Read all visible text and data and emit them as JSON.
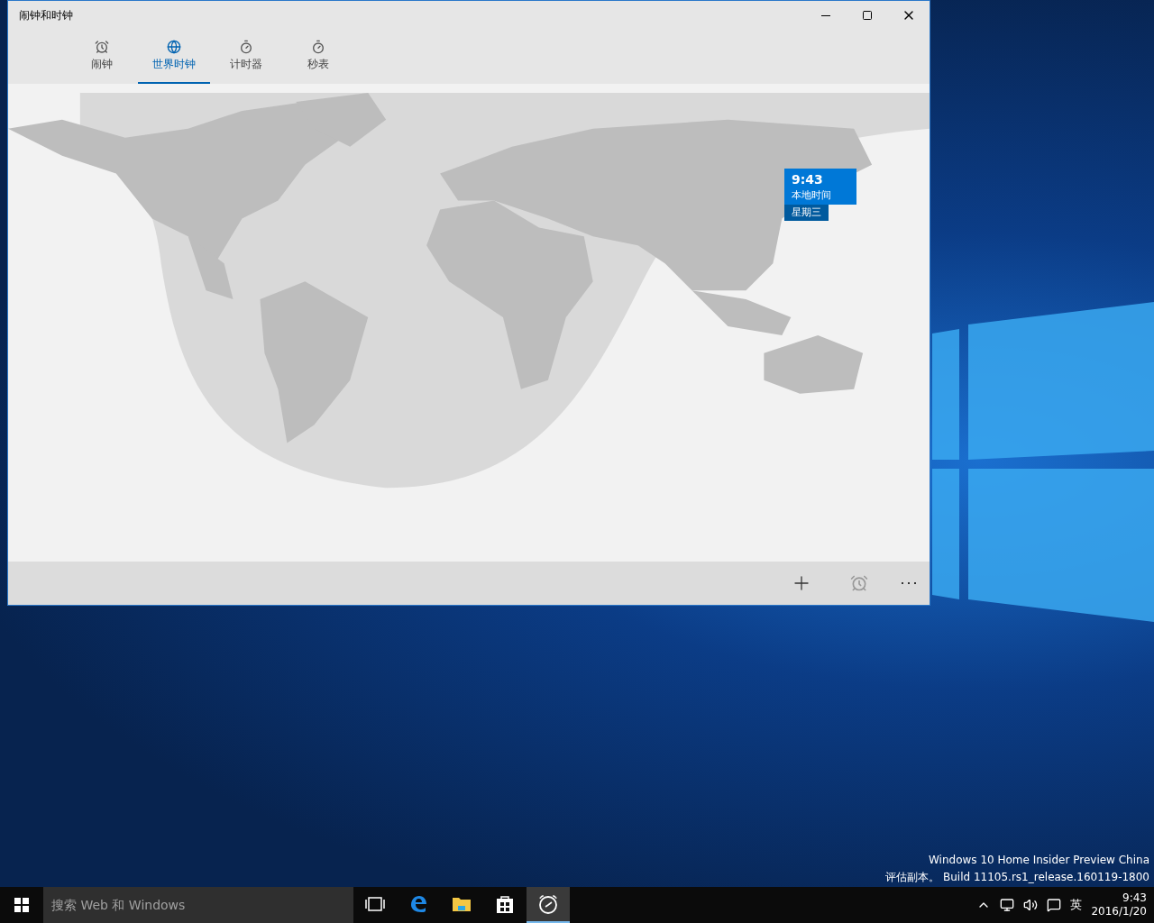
{
  "window": {
    "title": "闹钟和时钟"
  },
  "tabs": [
    {
      "kind": "alarm",
      "label": "闹钟",
      "selected": false
    },
    {
      "kind": "world",
      "label": "世界时钟",
      "selected": true
    },
    {
      "kind": "timer",
      "label": "计时器",
      "selected": false
    },
    {
      "kind": "stopwatch",
      "label": "秒表",
      "selected": false
    }
  ],
  "local_clock": {
    "time": "9:43",
    "label": "本地时间",
    "day": "星期三"
  },
  "desktop": {
    "edition": "Windows 10 Home Insider Preview China",
    "build": "评估副本。 Build 11105.rs1_release.160119-1800"
  },
  "taskbar": {
    "search": {
      "placeholder": "搜索 Web 和 Windows"
    },
    "apps": [
      {
        "kind": "task-view",
        "selected": false
      },
      {
        "kind": "edge",
        "selected": false
      },
      {
        "kind": "explorer",
        "selected": false
      },
      {
        "kind": "store",
        "selected": false
      },
      {
        "kind": "alarms",
        "selected": true
      }
    ],
    "input_method": "英",
    "time": "9:43",
    "date": "2016/1/20"
  }
}
